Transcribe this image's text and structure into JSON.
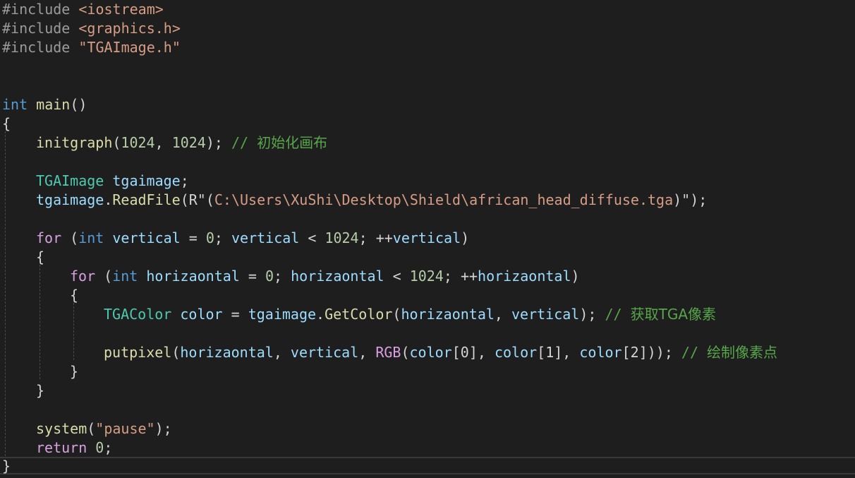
{
  "editor": {
    "lines": {
      "l1": {
        "pre": "#include",
        "file": "<iostream>"
      },
      "l2": {
        "pre": "#include",
        "file": "<graphics.h>"
      },
      "l3": {
        "pre": "#include",
        "file": "\"TGAImage.h\""
      },
      "l6": {
        "ret": "int",
        "fn": "main",
        "paren": "()"
      },
      "l7": {
        "brace": "{"
      },
      "l8": {
        "fn": "initgraph",
        "open": "(",
        "n1": "1024",
        "comma": ", ",
        "n2": "1024",
        "close": ");",
        "cmt": "// ",
        "cmt_text": "初始化画布"
      },
      "l10": {
        "type": "TGAImage",
        "var": "tgaimage",
        "semi": ";"
      },
      "l11": {
        "obj": "tgaimage",
        "dot": ".",
        "fn": "ReadFile",
        "open": "(",
        "pre": "R",
        "q1": "\"(",
        "path": "C:\\Users\\XuShi\\Desktop\\Shield\\african_head_diffuse.tga",
        "q2": ")\"",
        "close": ");"
      },
      "l13": {
        "kw": "for",
        "open": " (",
        "int": "int",
        "v1": "vertical",
        "eq": " = ",
        "n0": "0",
        "s1": "; ",
        "v2": "vertical",
        "lt": " < ",
        "n1": "1024",
        "s2": "; ",
        "inc": "++",
        "v3": "vertical",
        "close": ")"
      },
      "l14": {
        "brace": "{"
      },
      "l15": {
        "kw": "for",
        "open": " (",
        "int": "int",
        "v1": "horizaontal",
        "eq": " = ",
        "n0": "0",
        "s1": "; ",
        "v2": "horizaontal",
        "lt": " < ",
        "n1": "1024",
        "s2": "; ",
        "inc": "++",
        "v3": "horizaontal",
        "close": ")"
      },
      "l16": {
        "brace": "{"
      },
      "l17": {
        "type": "TGAColor",
        "var": "color",
        "eq": " = ",
        "obj": "tgaimage",
        "dot": ".",
        "fn": "GetColor",
        "open": "(",
        "a1": "horizaontal",
        "comma": ", ",
        "a2": "vertical",
        "close": ");",
        "cmt": " // ",
        "cmt_text": "获取TGA像素"
      },
      "l19": {
        "fn": "putpixel",
        "open": "(",
        "a1": "horizaontal",
        "c1": ", ",
        "a2": "vertical",
        "c2": ", ",
        "macro": "RGB",
        "o2": "(",
        "c_0": "color",
        "i0": "[0]",
        "c3": ", ",
        "c_1": "color",
        "i1": "[1]",
        "c4": ", ",
        "c_2": "color",
        "i2": "[2]",
        "close": "));",
        "cmt": " // ",
        "cmt_text": "绘制像素点"
      },
      "l20": {
        "brace": "}"
      },
      "l21": {
        "brace": "}"
      },
      "l23": {
        "fn": "system",
        "open": "(",
        "str": "\"pause\"",
        "close": ");"
      },
      "l24": {
        "kw": "return",
        "sp": " ",
        "n": "0",
        "semi": ";"
      },
      "l25": {
        "brace": "}"
      }
    },
    "colors": {
      "background": "#1e1e1e",
      "preprocessor": "#9b9b9b",
      "include_path": "#d69d85",
      "keyword": "#569cd6",
      "control": "#d8a0df",
      "function": "#dcdcaa",
      "type": "#4ec9b0",
      "variable": "#9cdcfe",
      "number": "#b5cea8",
      "string": "#d69d85",
      "comment": "#57a64a"
    }
  }
}
